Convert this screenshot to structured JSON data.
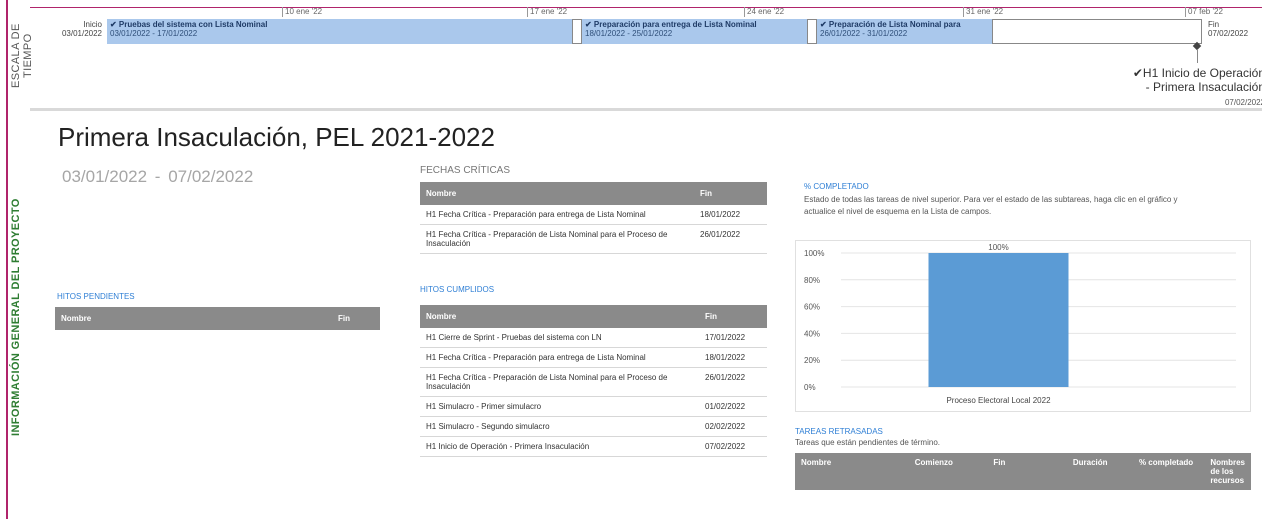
{
  "sidebar": {
    "timescale_label": "ESCALA DE TIEMPO",
    "overview_label": "INFORMACIÓN GENERAL DEL PROYECTO"
  },
  "timeline": {
    "date_ticks": [
      "10 ene '22",
      "17 ene '22",
      "24 ene '22",
      "31 ene '22",
      "07 feb '22"
    ],
    "start": {
      "label": "Inicio",
      "date": "03/01/2022"
    },
    "end": {
      "label": "Fin",
      "date": "07/02/2022"
    },
    "bars": [
      {
        "title": "✔ Pruebas del sistema con Lista Nominal",
        "range": "03/01/2022 - 17/01/2022"
      },
      {
        "title": "✔ Preparación para entrega de Lista Nominal",
        "range": "18/01/2022 - 25/01/2022"
      },
      {
        "title": "✔ Preparación de Lista Nominal para",
        "range": "26/01/2022 - 31/01/2022"
      }
    ],
    "milestone": {
      "line1": "✔H1 Inicio de Operación",
      "line2": "- Primera Insaculación",
      "date": "07/02/2022"
    }
  },
  "page": {
    "title": "Primera Insaculación, PEL 2021-2022",
    "date_range": "03/01/2022   -  07/02/2022"
  },
  "critical_dates": {
    "heading": "FECHAS CRÍTICAS",
    "headers": [
      "Nombre",
      "Fin"
    ],
    "rows": [
      [
        "H1 Fecha Crítica - Preparación para entrega de Lista Nominal",
        "18/01/2022"
      ],
      [
        "H1 Fecha Crítica - Preparación de Lista Nominal para el Proceso de Insaculación",
        "26/01/2022"
      ]
    ]
  },
  "pending": {
    "heading": "HITOS PENDIENTES",
    "headers": [
      "Nombre",
      "Fin"
    ]
  },
  "completed": {
    "heading": "HITOS CUMPLIDOS",
    "headers": [
      "Nombre",
      "Fin"
    ],
    "rows": [
      [
        "H1 Cierre de Sprint - Pruebas del sistema con LN",
        "17/01/2022"
      ],
      [
        "H1 Fecha Crítica - Preparación para entrega de Lista Nominal",
        "18/01/2022"
      ],
      [
        "H1 Fecha Crítica - Preparación de Lista Nominal para el Proceso de Insaculación",
        "26/01/2022"
      ],
      [
        "H1 Simulacro - Primer simulacro",
        "01/02/2022"
      ],
      [
        "H1 Simulacro - Segundo simulacro",
        "02/02/2022"
      ],
      [
        "H1 Inicio de Operación - Primera Insaculación",
        "07/02/2022"
      ]
    ]
  },
  "percent": {
    "heading": "% COMPLETADO",
    "description": "Estado de todas las tareas de nivel superior. Para ver el estado de las subtareas, haga clic en el gráfico y actualice el nivel de esquema en la Lista de campos."
  },
  "chart_data": {
    "type": "bar",
    "categories": [
      "Proceso Electoral Local 2022"
    ],
    "values": [
      100
    ],
    "data_labels": [
      "100%"
    ],
    "y_ticks": [
      "0%",
      "20%",
      "40%",
      "60%",
      "80%",
      "100%"
    ],
    "ylim": [
      0,
      100
    ],
    "bar_color": "#5b9bd5",
    "grid": true
  },
  "delayed": {
    "heading": "TAREAS RETRASADAS",
    "subtitle": "Tareas que están pendientes de término.",
    "headers": [
      "Nombre",
      "Comienzo",
      "Fin",
      "Duración",
      "% completado",
      "Nombres de los recursos"
    ]
  }
}
